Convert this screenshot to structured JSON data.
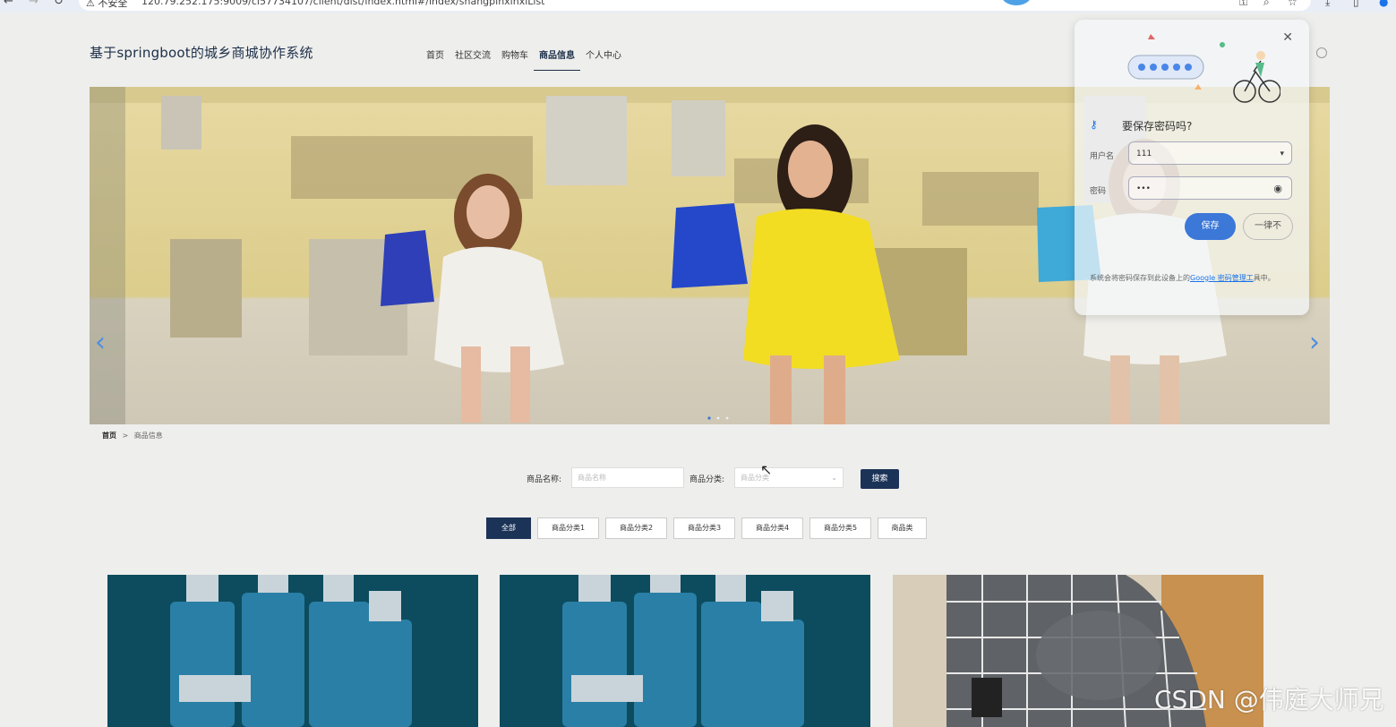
{
  "browser": {
    "insecure_label": "⚠ 不安全",
    "url": "120.79.252.175:9009/cl57734107/client/dist/index.html#/index/shangpinxinxiList"
  },
  "site": {
    "title": "基于springboot的城乡商城协作系统"
  },
  "nav": {
    "items": [
      "首页",
      "社区交流",
      "购物车",
      "商品信息",
      "个人中心"
    ],
    "active_index": 3
  },
  "banner": {
    "prev_arrow": "‹",
    "next_arrow": "›",
    "slide_count": 3,
    "active_slide": 0
  },
  "password_popup": {
    "title": "要保存密码吗?",
    "username_label": "用户名",
    "username_value": "111",
    "password_label": "密码",
    "password_value": "•••",
    "save_label": "保存",
    "never_label": "一律不",
    "note_prefix": "系统会将密码保存到此设备上的",
    "note_link": "Google 密码管理工",
    "note_suffix": "具中。"
  },
  "breadcrumb": {
    "home": "首页",
    "separator": ">",
    "current": "商品信息"
  },
  "search": {
    "name_label": "商品名称:",
    "name_placeholder": "商品名称",
    "category_label": "商品分类:",
    "category_placeholder": "商品分类",
    "button_label": "搜索"
  },
  "categories": [
    "全部",
    "商品分类1",
    "商品分类2",
    "商品分类3",
    "商品分类4",
    "商品分类5",
    "商品类"
  ],
  "active_category": 0,
  "products": [
    {
      "image": "serum-bottles"
    },
    {
      "image": "serum-bottles"
    },
    {
      "image": "plaid-cushion"
    }
  ],
  "watermark": "CSDN @伟庭大师兄",
  "colors": {
    "primary": "#1c3358",
    "google_blue": "#3b78d8"
  }
}
